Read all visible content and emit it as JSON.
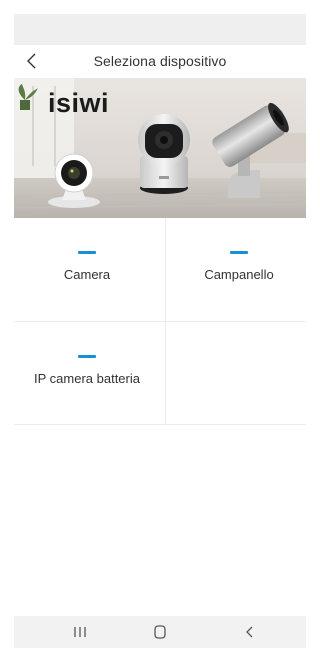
{
  "nav": {
    "title": "Seleziona dispositivo"
  },
  "banner": {
    "brand": "isiwi"
  },
  "devices": [
    {
      "label": "Camera"
    },
    {
      "label": "Campanello"
    },
    {
      "label": "IP camera batteria"
    }
  ],
  "colors": {
    "accent": "#1a8fd6",
    "status_bar": "#efefef",
    "bottom_nav": "#f2f2f2",
    "divider": "#ececec"
  },
  "icons": {
    "back": "chevron-left-icon",
    "recents": "recents-icon",
    "home": "home-icon",
    "system_back": "system-back-icon"
  }
}
